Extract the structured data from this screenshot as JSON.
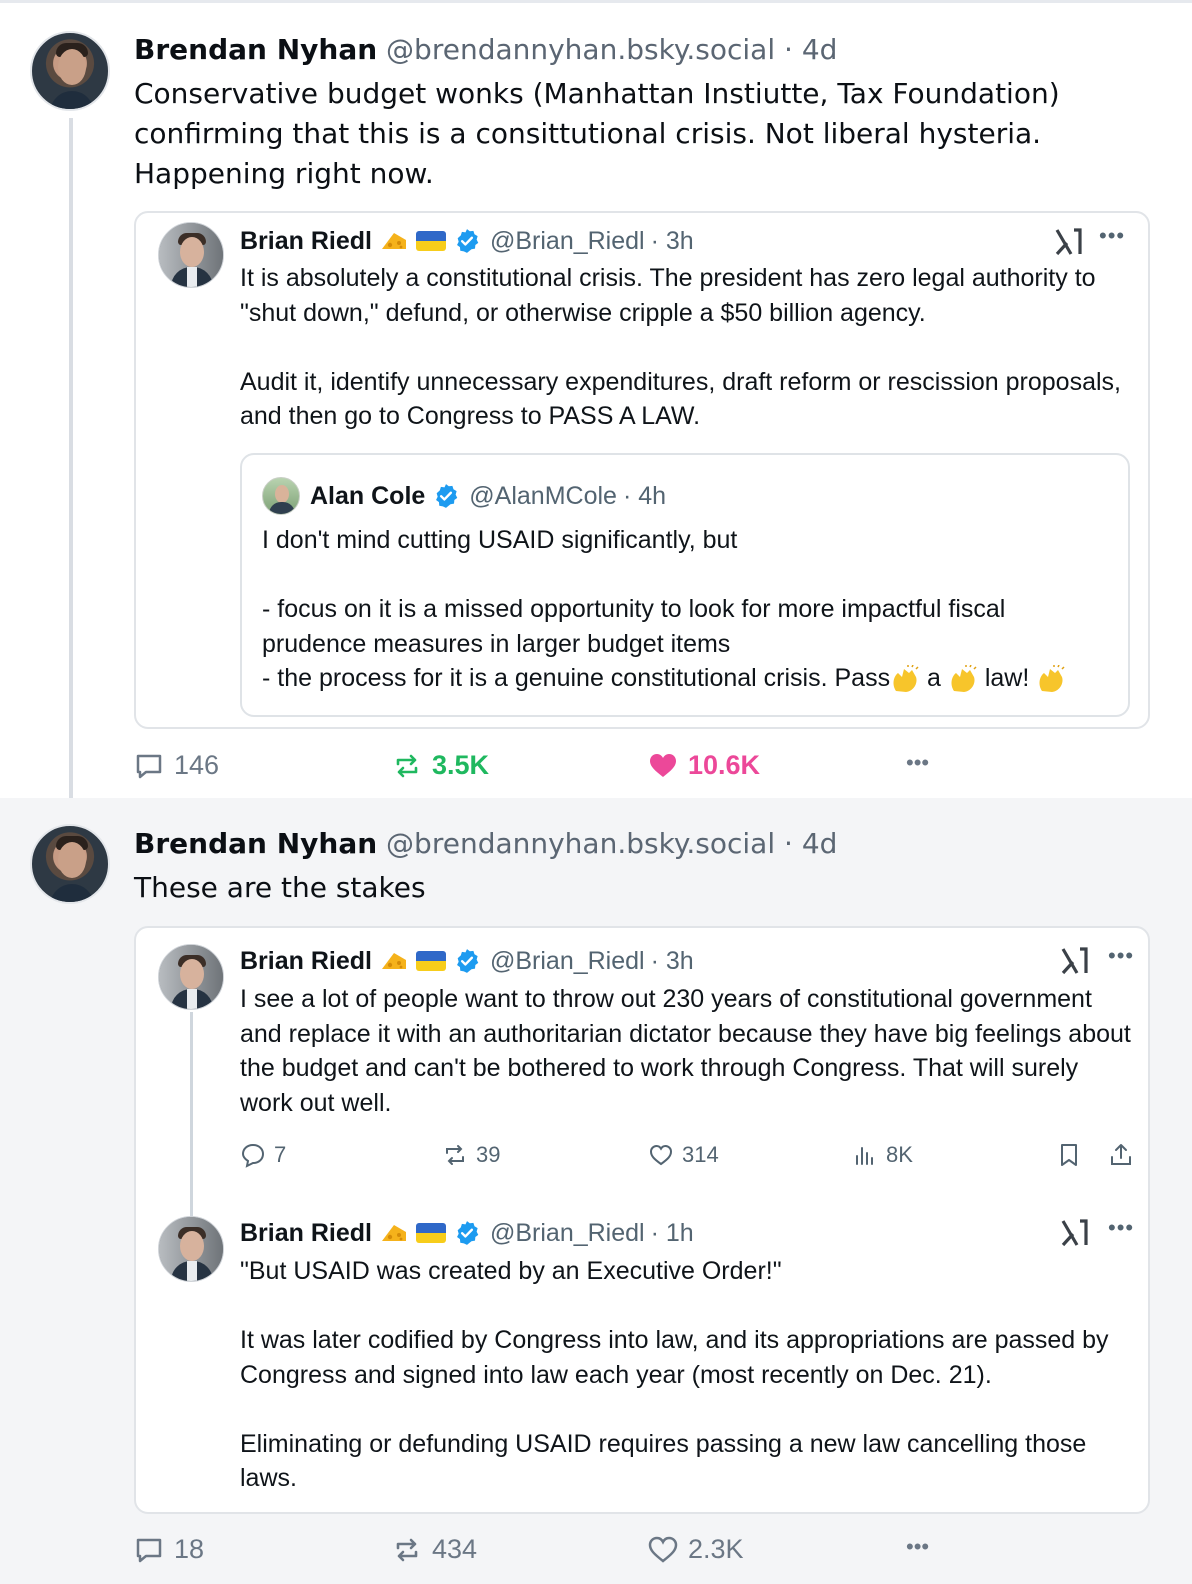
{
  "post1": {
    "author_name": "Brendan Nyhan",
    "author_handle": "@brendannyhan.bsky.social",
    "time": "· 4d",
    "text": "Conservative budget wonks (Manhattan Instiutte, Tax Foundation)\nconfirming that this is a consittutional crisis. Not liberal hysteria.\nHappening right now.",
    "quote": {
      "author_name": "Brian Riedl",
      "author_handle": "@Brian_Riedl",
      "time": "· 3h",
      "text": "It is absolutely a constitutional crisis. The president has zero legal authority to\n\"shut down,\" defund, or otherwise cripple a $50 billion agency.\n\nAudit it, identify unnecessary expenditures, draft reform or rescission proposals,\nand then go to Congress to PASS A LAW.",
      "nested": {
        "author_name": "Alan Cole",
        "author_handle": "@AlanMCole",
        "time": "· 4h",
        "text": "I don't mind cutting USAID significantly, but\n\n- focus on it is a missed opportunity to look for more impactful fiscal\nprudence measures in larger budget items",
        "last_line_start": "- the process for it is a genuine constitutional crisis. Pass",
        "last_line_mid": " a ",
        "last_line_end": " law! "
      }
    },
    "actions": {
      "replies": "146",
      "reposts": "3.5K",
      "likes": "10.6K"
    },
    "colors": {
      "repost": "#1fb85f",
      "like": "#ec4899"
    }
  },
  "post2": {
    "author_name": "Brendan Nyhan",
    "author_handle": "@brendannyhan.bsky.social",
    "time": "· 4d",
    "text": "These are the stakes",
    "quote1": {
      "author_name": "Brian Riedl",
      "author_handle": "@Brian_Riedl",
      "time": "· 3h",
      "text": "I see a lot of people want to throw out 230 years of constitutional government\nand replace it with an authoritarian dictator because they have big feelings about\nthe budget and can't be bothered to work through Congress. That will surely\nwork out well.",
      "stats": {
        "replies": "7",
        "reposts": "39",
        "likes": "314",
        "views": "8K"
      }
    },
    "quote2": {
      "author_name": "Brian Riedl",
      "author_handle": "@Brian_Riedl",
      "time": "· 1h",
      "text": "\"But USAID was created by an Executive Order!\"\n\nIt was later codified by Congress into law, and its appropriations are passed by\nCongress and signed into law each year (most recently on Dec. 21).\n\nEliminating or defunding USAID requires passing a new law cancelling those\nlaws."
    },
    "actions": {
      "replies": "18",
      "reposts": "434",
      "likes": "2.3K"
    }
  },
  "icons": [
    "reply-icon",
    "repost-icon",
    "like-icon",
    "more-icon",
    "verified-icon",
    "x-logo-icon",
    "bookmark-icon",
    "share-icon",
    "views-icon",
    "clap-emoji",
    "cheese-emoji",
    "ukraine-flag"
  ]
}
